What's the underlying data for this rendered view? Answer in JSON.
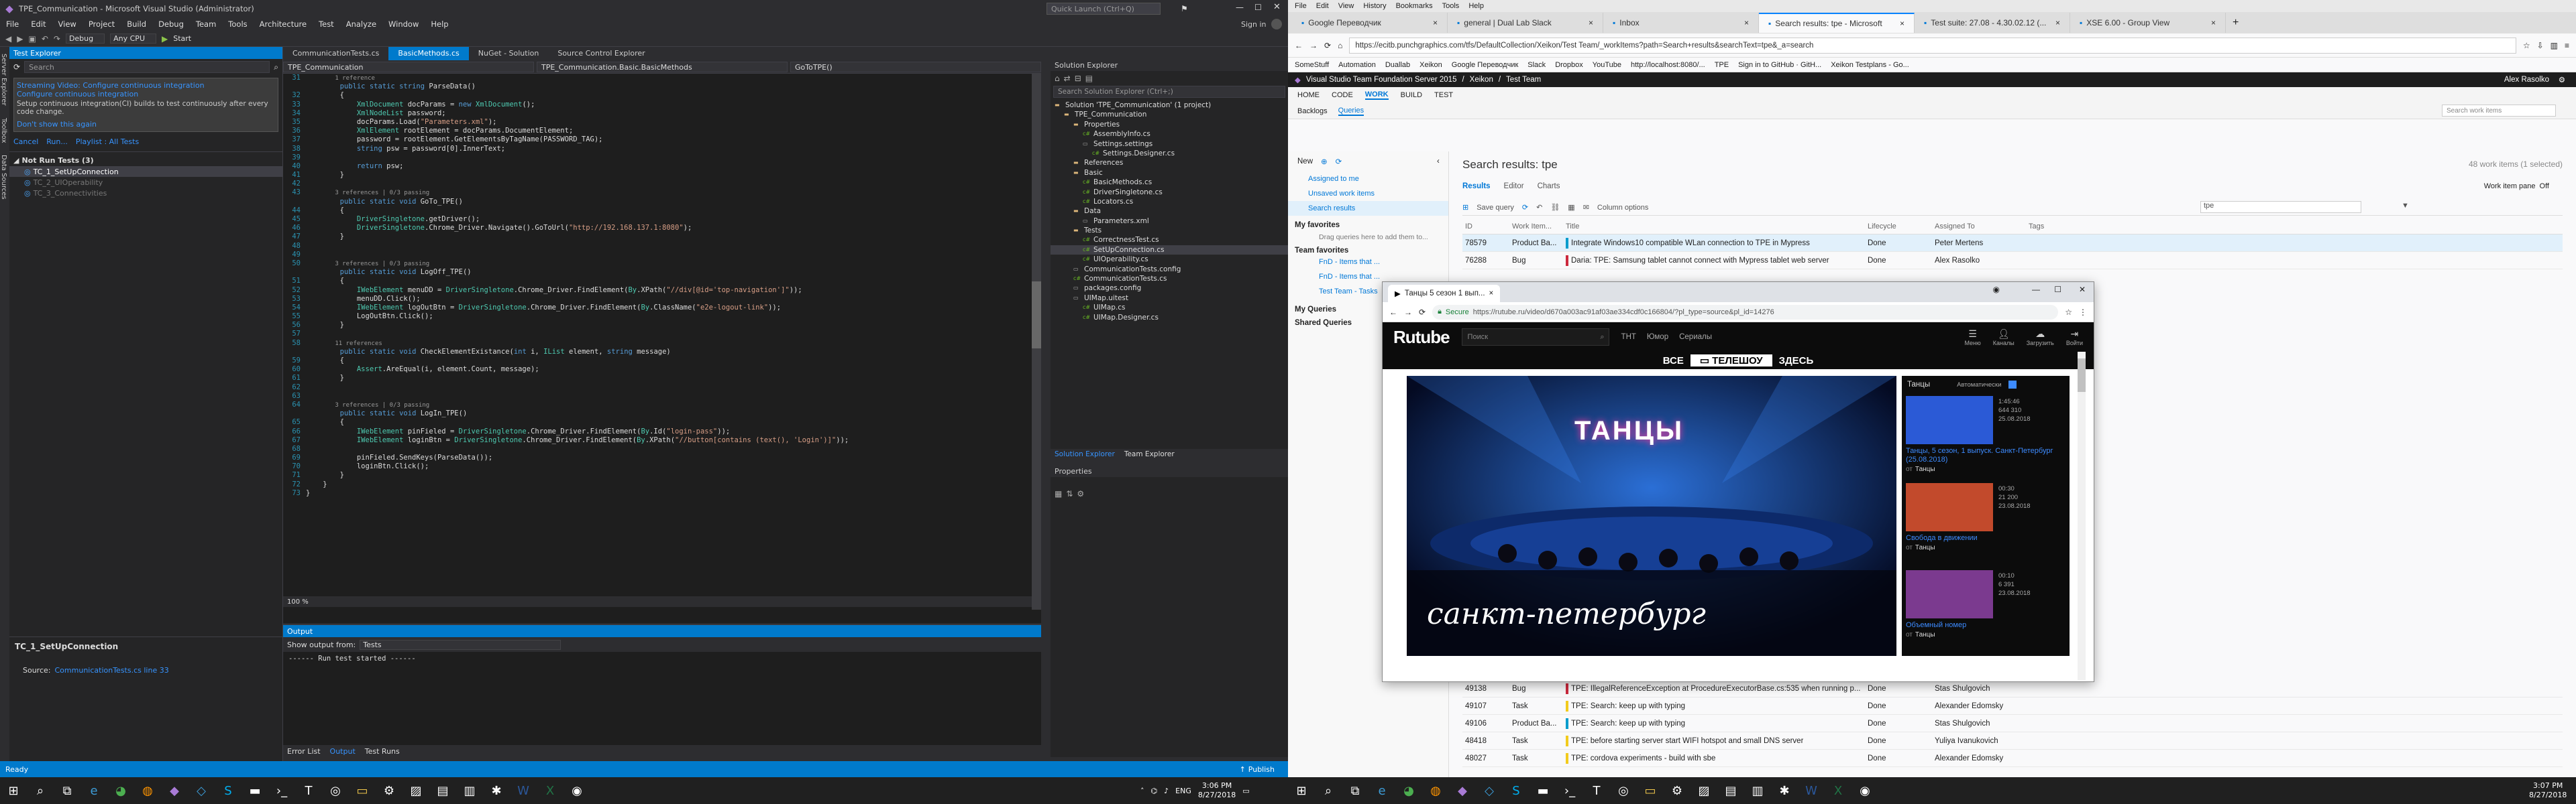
{
  "vs": {
    "title": "TPE_Communication - Microsoft Visual Studio (Administrator)",
    "menu": [
      "File",
      "Edit",
      "View",
      "Project",
      "Build",
      "Debug",
      "Team",
      "Tools",
      "Architecture",
      "Test",
      "Analyze",
      "Window",
      "Help"
    ],
    "quick_launch": "Quick Launch (Ctrl+Q)",
    "sign_in": "Sign in",
    "toolbar": {
      "start": "Start",
      "config": "Debug",
      "platform": "Any CPU"
    },
    "side_tabs": [
      "Server Explorer",
      "Toolbox",
      "Data Sources"
    ],
    "test_explorer": {
      "title": "Test Explorer",
      "search": "Search",
      "info": "Streaming Video: Configure continuous integration",
      "info_sub": "Configure continuous integration",
      "info_desc": "Setup continuous integration(CI) builds to test continuously after every code change.",
      "dont_show": "Don't show this again",
      "actions": [
        "Cancel",
        "Run...",
        "Playlist : All Tests"
      ],
      "group": "Not Run Tests (3)",
      "tests": [
        "TC_1_SetUpConnection",
        "TC_2_UIOperability",
        "TC_3_Connectivities"
      ],
      "detail_title": "TC_1_SetUpConnection",
      "detail_source_label": "Source:",
      "detail_source": "CommunicationTests.cs line 33"
    },
    "editor": {
      "tabs": [
        "CommunicationTests.cs",
        "BasicMethods.cs",
        "NuGet - Solution",
        "Source Control Explorer"
      ],
      "active_tab": "BasicMethods.cs",
      "nav": [
        "TPE_Communication",
        "TPE_Communication.Basic.BasicMethods",
        "GoToTPE()"
      ],
      "zoom": "100 %",
      "lines": [
        {
          "n": "31",
          "t": "        1 reference",
          "c": "cm"
        },
        {
          "n": "",
          "t": "        public static string ParseData()",
          "c": ""
        },
        {
          "n": "32",
          "t": "        {",
          "c": ""
        },
        {
          "n": "33",
          "t": "            XmlDocument docParams = new XmlDocument();",
          "c": ""
        },
        {
          "n": "34",
          "t": "            XmlNodeList password;",
          "c": ""
        },
        {
          "n": "35",
          "t": "            docParams.Load(\"Parameters.xml\");",
          "c": ""
        },
        {
          "n": "36",
          "t": "            XmlElement rootElement = docParams.DocumentElement;",
          "c": ""
        },
        {
          "n": "37",
          "t": "            password = rootElement.GetElementsByTagName(PASSWORD_TAG);",
          "c": ""
        },
        {
          "n": "38",
          "t": "            string psw = password[0].InnerText;",
          "c": ""
        },
        {
          "n": "39",
          "t": "",
          "c": ""
        },
        {
          "n": "40",
          "t": "            return psw;",
          "c": ""
        },
        {
          "n": "41",
          "t": "        }",
          "c": ""
        },
        {
          "n": "42",
          "t": "",
          "c": ""
        },
        {
          "n": "43",
          "t": "        3 references | 0/3 passing",
          "c": "cm"
        },
        {
          "n": "",
          "t": "        public static void GoTo_TPE()",
          "c": ""
        },
        {
          "n": "44",
          "t": "        {",
          "c": ""
        },
        {
          "n": "45",
          "t": "            DriverSingletone.getDriver();",
          "c": ""
        },
        {
          "n": "46",
          "t": "            DriverSingletone.Chrome_Driver.Navigate().GoToUrl(\"http://192.168.137.1:8080\");",
          "c": ""
        },
        {
          "n": "47",
          "t": "        }",
          "c": ""
        },
        {
          "n": "48",
          "t": "",
          "c": ""
        },
        {
          "n": "49",
          "t": "",
          "c": ""
        },
        {
          "n": "50",
          "t": "        3 references | 0/3 passing",
          "c": "cm"
        },
        {
          "n": "",
          "t": "        public static void LogOff_TPE()",
          "c": ""
        },
        {
          "n": "51",
          "t": "        {",
          "c": ""
        },
        {
          "n": "52",
          "t": "            IWebElement menuDD = DriverSingletone.Chrome_Driver.FindElement(By.XPath(\"//div[@id='top-navigation']\"));",
          "c": ""
        },
        {
          "n": "53",
          "t": "            menuDD.Click();",
          "c": ""
        },
        {
          "n": "54",
          "t": "            IWebElement logOutBtn = DriverSingletone.Chrome_Driver.FindElement(By.ClassName(\"e2e-logout-link\"));",
          "c": ""
        },
        {
          "n": "55",
          "t": "            LogOutBtn.Click();",
          "c": ""
        },
        {
          "n": "56",
          "t": "        }",
          "c": ""
        },
        {
          "n": "57",
          "t": "",
          "c": ""
        },
        {
          "n": "58",
          "t": "        11 references",
          "c": "cm"
        },
        {
          "n": "",
          "t": "        public static void CheckElementExistance(int i, IList element, string message)",
          "c": ""
        },
        {
          "n": "59",
          "t": "        {",
          "c": ""
        },
        {
          "n": "60",
          "t": "            Assert.AreEqual(i, element.Count, message);",
          "c": ""
        },
        {
          "n": "61",
          "t": "        }",
          "c": ""
        },
        {
          "n": "62",
          "t": "",
          "c": ""
        },
        {
          "n": "63",
          "t": "",
          "c": ""
        },
        {
          "n": "64",
          "t": "        3 references | 0/3 passing",
          "c": "cm"
        },
        {
          "n": "",
          "t": "        public static void LogIn_TPE()",
          "c": ""
        },
        {
          "n": "65",
          "t": "        {",
          "c": ""
        },
        {
          "n": "66",
          "t": "            IWebElement pinFieled = DriverSingletone.Chrome_Driver.FindElement(By.Id(\"login-pass\"));",
          "c": ""
        },
        {
          "n": "67",
          "t": "            IWebElement loginBtn = DriverSingletone.Chrome_Driver.FindElement(By.XPath(\"//button[contains (text(), 'Login')]\"));",
          "c": ""
        },
        {
          "n": "68",
          "t": "",
          "c": ""
        },
        {
          "n": "69",
          "t": "            pinFieled.SendKeys(ParseData());",
          "c": ""
        },
        {
          "n": "70",
          "t": "            loginBtn.Click();",
          "c": ""
        },
        {
          "n": "71",
          "t": "        }",
          "c": ""
        },
        {
          "n": "72",
          "t": "    }",
          "c": ""
        },
        {
          "n": "73",
          "t": "}",
          "c": ""
        }
      ]
    },
    "output": {
      "title": "Output",
      "show_from_label": "Show output from:",
      "show_from": "Tests",
      "text": "------ Run test started ------",
      "tabs": [
        "Error List",
        "Output",
        "Test Runs"
      ]
    },
    "solution_explorer": {
      "title": "Solution Explorer",
      "search": "Search Solution Explorer (Ctrl+;)",
      "items": [
        {
          "d": 0,
          "t": "Solution 'TPE_Communication' (1 project)"
        },
        {
          "d": 1,
          "t": "TPE_Communication"
        },
        {
          "d": 2,
          "t": "Properties"
        },
        {
          "d": 3,
          "t": "AssemblyInfo.cs"
        },
        {
          "d": 3,
          "t": "Settings.settings"
        },
        {
          "d": 4,
          "t": "Settings.Designer.cs"
        },
        {
          "d": 2,
          "t": "References"
        },
        {
          "d": 2,
          "t": "Basic"
        },
        {
          "d": 3,
          "t": "BasicMethods.cs"
        },
        {
          "d": 3,
          "t": "DriverSingletone.cs"
        },
        {
          "d": 3,
          "t": "Locators.cs"
        },
        {
          "d": 2,
          "t": "Data"
        },
        {
          "d": 3,
          "t": "Parameters.xml"
        },
        {
          "d": 2,
          "t": "Tests"
        },
        {
          "d": 3,
          "t": "CorrectnessTest.cs"
        },
        {
          "d": 3,
          "t": "SetUpConnection.cs"
        },
        {
          "d": 3,
          "t": "UIOperability.cs"
        },
        {
          "d": 2,
          "t": "CommunicationTests.config"
        },
        {
          "d": 2,
          "t": "CommunicationTests.cs"
        },
        {
          "d": 2,
          "t": "packages.config"
        },
        {
          "d": 2,
          "t": "UIMap.uitest"
        },
        {
          "d": 3,
          "t": "UIMap.cs"
        },
        {
          "d": 3,
          "t": "UIMap.Designer.cs"
        }
      ],
      "bottom_tabs": [
        "Solution Explorer",
        "Team Explorer"
      ],
      "properties_title": "Properties"
    },
    "status": {
      "ready": "Ready",
      "publish": "Publish"
    }
  },
  "firefox": {
    "menu": [
      "File",
      "Edit",
      "View",
      "History",
      "Bookmarks",
      "Tools",
      "Help"
    ],
    "tabs": [
      "Google Переводчик",
      "general | Dual Lab Slack",
      "Inbox",
      "Search results: tpe - Microsoft",
      "Test suite: 27.08 - 4.30.02.12 (...",
      "XSE 6.00 - Group View"
    ],
    "active_tab": 3,
    "url": "https://ecitb.punchgraphics.com/tfs/DefaultCollection/Xeikon/Test Team/_workItems?path=Search+results&searchText=tpe&_a=search",
    "bookmarks": [
      "SomeStuff",
      "Automation",
      "Duallab",
      "Xeikon",
      "Google Переводчик",
      "Slack",
      "Dropbox",
      "YouTube",
      "http://localhost:8080/...",
      "TPE",
      "Sign in to GitHub · GitH...",
      "Xeikon Testplans - Go..."
    ]
  },
  "tfs": {
    "product": "Visual Studio Team Foundation Server 2015",
    "crumbs": [
      "Xeikon",
      "Test Team"
    ],
    "user": "Alex Rasolko",
    "hubs": [
      "HOME",
      "CODE",
      "WORK",
      "BUILD",
      "TEST"
    ],
    "active_hub": "WORK",
    "subhubs": [
      "Backlogs",
      "Queries"
    ],
    "search_placeholder": "Search work items",
    "new_label": "New",
    "left_links": [
      "Assigned to me",
      "Unsaved work items",
      "Search results"
    ],
    "favorites": "My favorites",
    "fav_hint": "Drag queries here to add them to...",
    "team_fav": "Team favorites",
    "team_items": [
      "FnD - Items that ...",
      "FnD - Items that ...",
      "Test Team - Tasks"
    ],
    "my_queries": "My Queries",
    "shared_queries": "Shared Queries",
    "results_title": "Search results: tpe",
    "results_count": "48 work items (1 selected)",
    "result_tabs": [
      "Results",
      "Editor",
      "Charts"
    ],
    "work_item_pane_label": "Work item pane",
    "work_item_pane": "Off",
    "save_query": "Save query",
    "column_options": "Column options",
    "filter": "tpe",
    "columns": [
      "ID",
      "Work Item...",
      "Title",
      "Lifecycle",
      "Assigned To",
      "Tags"
    ],
    "rows": [
      {
        "id": "78579",
        "type": "Product Ba...",
        "title": "Integrate Windows10 compatible WLan connection to TPE in Mypress",
        "state": "Done",
        "who": "Peter Mertens",
        "color": "#009ccc",
        "sel": true
      },
      {
        "id": "76288",
        "type": "Bug",
        "title": "Daria: TPE: Samsung tablet cannot connect with Mypress tablet web server",
        "state": "Done",
        "who": "Alex Rasolko",
        "color": "#cc293d",
        "sel": false
      },
      {
        "id": "49138",
        "type": "Bug",
        "title": "TPE: IllegalReferenceException at ProcedureExecutorBase.cs:535 when running p...",
        "state": "Done",
        "who": "Stas Shulgovich",
        "color": "#cc293d",
        "sel": false
      },
      {
        "id": "49107",
        "type": "Task",
        "title": "TPE: Search: keep up with typing",
        "state": "Done",
        "who": "Alexander Edomsky",
        "color": "#f2cb1d",
        "sel": false
      },
      {
        "id": "49106",
        "type": "Product Ba...",
        "title": "TPE: Search: keep up with typing",
        "state": "Done",
        "who": "Stas Shulgovich",
        "color": "#009ccc",
        "sel": false
      },
      {
        "id": "48418",
        "type": "Task",
        "title": "TPE: before starting server start WIFI hotspot and small DNS server",
        "state": "Done",
        "who": "Yuliya Ivanukovich",
        "color": "#f2cb1d",
        "sel": false
      },
      {
        "id": "48027",
        "type": "Task",
        "title": "TPE: cordova experiments - build with sbe",
        "state": "Done",
        "who": "Alexander Edomsky",
        "color": "#f2cb1d",
        "sel": false
      }
    ]
  },
  "rutube": {
    "tab_title": "Танцы 5 сезон 1 вып...",
    "secure": "Secure",
    "url": "https://rutube.ru/video/d670a003ac91af03ae334cdf0c166804/?pl_type=source&pl_id=14276",
    "logo": "Rutube",
    "search_placeholder": "Поиск",
    "nav": [
      "ТНТ",
      "Юмор",
      "Сериалы"
    ],
    "icons": [
      "Меню",
      "Каналы",
      "Загрузить",
      "Войти"
    ],
    "banner_left": "ВСЕ",
    "banner_mid": "ТЕЛЕШОУ",
    "banner_right": "ЗДЕСЬ",
    "video_title": "ТАНЦЫ",
    "video_subtitle": "санкт-петербург",
    "playlist_title": "Танцы",
    "autoplay": "Автоматически",
    "playlist": [
      {
        "dur": "1:45:46",
        "views": "644 310",
        "date": "25.08.2018",
        "title": "Танцы, 5 сезон, 1 выпуск. Санкт-Петербург (25.08.2018)",
        "ch": "Танцы"
      },
      {
        "dur": "00:30",
        "views": "21 200",
        "date": "23.08.2018",
        "title": "Свобода в движении",
        "ch": "Танцы"
      },
      {
        "dur": "00:10",
        "views": "6 391",
        "date": "23.08.2018",
        "title": "Объемный номер",
        "ch": "Танцы"
      }
    ],
    "by_prefix": "от"
  },
  "taskbar": {
    "lang": "ENG",
    "time_left": "3:06 PM",
    "date_left": "8/27/2018",
    "time_right": "3:07 PM",
    "date_right": "8/27/2018",
    "icons": [
      "windows-icon",
      "search-icon",
      "task-view-icon",
      "edge-icon",
      "chrome-icon",
      "firefox-icon",
      "vs-icon",
      "vs-blue-icon",
      "skype-icon",
      "explorer-icon",
      "terminal-icon",
      "teams-icon",
      "globe-icon",
      "folder-icon",
      "settings-icon",
      "photo-icon",
      "document-icon",
      "chart-icon",
      "bug-icon",
      "word-icon",
      "excel-icon",
      "globe2-icon"
    ]
  }
}
